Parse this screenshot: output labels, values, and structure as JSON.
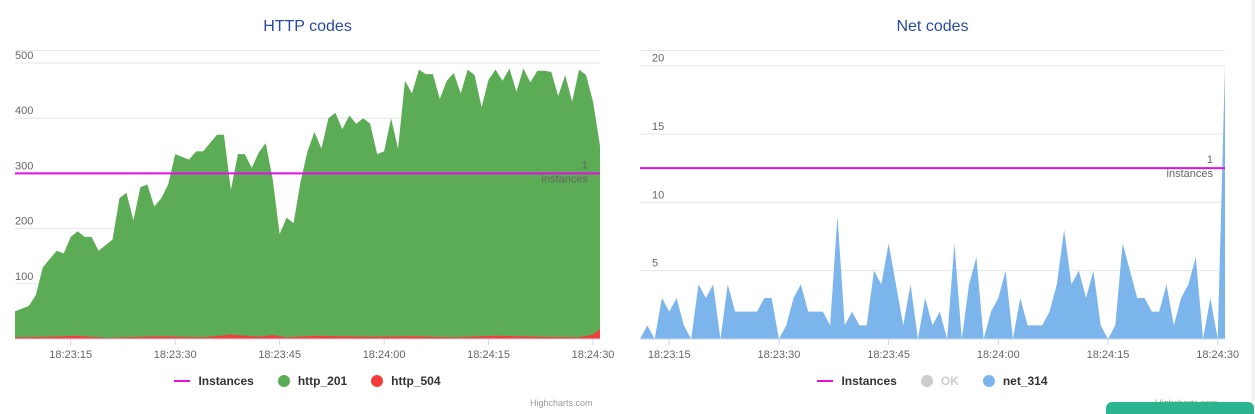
{
  "charts": [
    {
      "title": "HTTP codes",
      "credits": "Highcharts.com",
      "plot_line_label": [
        "1",
        "instances"
      ],
      "legend": [
        {
          "label": "Instances",
          "symbol": "line",
          "color": "#e60ee6",
          "disabled": false
        },
        {
          "label": "http_201",
          "symbol": "dot",
          "color": "#5bac55",
          "disabled": false
        },
        {
          "label": "http_504",
          "symbol": "dot",
          "color": "#f33e3e",
          "disabled": false
        }
      ]
    },
    {
      "title": "Net codes",
      "credits": "Highcharts.com",
      "plot_line_label": [
        "1",
        "instances"
      ],
      "legend": [
        {
          "label": "Instances",
          "symbol": "line",
          "color": "#e60ee6",
          "disabled": false
        },
        {
          "label": "OK",
          "symbol": "dot",
          "color": "#cccccc",
          "disabled": true
        },
        {
          "label": "net_314",
          "symbol": "dot",
          "color": "#7cb5ec",
          "disabled": false
        }
      ]
    }
  ],
  "chart_data": [
    {
      "type": "area",
      "title": "HTTP codes",
      "x_ticks": [
        "18:23:15",
        "18:23:30",
        "18:23:45",
        "18:24:00",
        "18:24:15",
        "18:24:30"
      ],
      "x_tick_seconds": [
        15,
        30,
        45,
        60,
        75,
        90
      ],
      "x_range_seconds": [
        7,
        91
      ],
      "y_ticks": [
        100,
        200,
        300,
        400,
        500
      ],
      "ylim": [
        0,
        520
      ],
      "grid": true,
      "plot_line": {
        "series": "Instances",
        "value": 1,
        "y_level": 300,
        "color": "#e60ee6"
      },
      "series": [
        {
          "name": "http_201",
          "color": "#5bac55",
          "x": [
            7,
            8,
            9,
            10,
            11,
            12,
            13,
            14,
            15,
            16,
            17,
            18,
            19,
            20,
            21,
            22,
            23,
            24,
            25,
            26,
            27,
            28,
            29,
            30,
            31,
            32,
            33,
            34,
            35,
            36,
            37,
            38,
            39,
            40,
            41,
            42,
            43,
            44,
            45,
            46,
            47,
            48,
            49,
            50,
            51,
            52,
            53,
            54,
            55,
            56,
            57,
            58,
            59,
            60,
            61,
            62,
            63,
            64,
            65,
            66,
            67,
            68,
            69,
            70,
            71,
            72,
            73,
            74,
            75,
            76,
            77,
            78,
            79,
            80,
            81,
            82,
            83,
            84,
            85,
            86,
            87,
            88,
            89,
            90,
            91
          ],
          "values": [
            50,
            55,
            60,
            80,
            130,
            145,
            160,
            155,
            185,
            195,
            185,
            185,
            160,
            170,
            180,
            255,
            265,
            215,
            275,
            280,
            240,
            255,
            280,
            335,
            330,
            325,
            340,
            340,
            355,
            370,
            370,
            270,
            335,
            335,
            310,
            338,
            355,
            290,
            190,
            220,
            210,
            285,
            340,
            375,
            345,
            400,
            410,
            380,
            405,
            390,
            400,
            390,
            335,
            340,
            400,
            345,
            468,
            445,
            488,
            480,
            480,
            435,
            468,
            482,
            445,
            488,
            478,
            420,
            470,
            488,
            468,
            490,
            448,
            490,
            465,
            486,
            486,
            484,
            440,
            478,
            430,
            488,
            478,
            430,
            350
          ]
        },
        {
          "name": "http_504",
          "color": "#f33e3e",
          "x": [
            7,
            12,
            16,
            20,
            28,
            34,
            38,
            42,
            44,
            46,
            50,
            58,
            64,
            70,
            76,
            82,
            88,
            90,
            91
          ],
          "values": [
            3,
            4,
            6,
            2,
            5,
            3,
            8,
            4,
            7,
            3,
            6,
            4,
            5,
            3,
            6,
            4,
            3,
            8,
            18
          ]
        }
      ]
    },
    {
      "type": "area",
      "title": "Net codes",
      "x_ticks": [
        "18:23:15",
        "18:23:30",
        "18:23:45",
        "18:24:00",
        "18:24:15",
        "18:24:30"
      ],
      "x_tick_seconds": [
        15,
        30,
        45,
        60,
        75,
        90
      ],
      "x_range_seconds": [
        11,
        91
      ],
      "y_ticks": [
        5,
        10,
        15,
        20
      ],
      "ylim": [
        0,
        21
      ],
      "grid": true,
      "plot_line": {
        "series": "Instances",
        "value": 1,
        "y_level": 12.5,
        "color": "#e60ee6"
      },
      "series": [
        {
          "name": "OK",
          "color": "#cccccc",
          "x": [],
          "values": []
        },
        {
          "name": "net_314",
          "color": "#7cb5ec",
          "x": [
            11,
            12,
            13,
            14,
            15,
            16,
            17,
            18,
            19,
            20,
            21,
            22,
            23,
            24,
            25,
            26,
            27,
            28,
            29,
            30,
            31,
            32,
            33,
            34,
            35,
            36,
            37,
            38,
            39,
            40,
            41,
            42,
            43,
            44,
            45,
            46,
            47,
            48,
            49,
            50,
            51,
            52,
            53,
            54,
            55,
            56,
            57,
            58,
            59,
            60,
            61,
            62,
            63,
            64,
            65,
            66,
            67,
            68,
            69,
            70,
            71,
            72,
            73,
            74,
            75,
            76,
            77,
            78,
            79,
            80,
            81,
            82,
            83,
            84,
            85,
            86,
            87,
            88,
            89,
            90,
            91
          ],
          "values": [
            0,
            1,
            0,
            3,
            2,
            3,
            1,
            0,
            4,
            3,
            4,
            0,
            4,
            2,
            2,
            2,
            2,
            3,
            3,
            0,
            1,
            3,
            4,
            2,
            2,
            2,
            1,
            9,
            1,
            2,
            1,
            1,
            5,
            4,
            7,
            4,
            1,
            4,
            0,
            3,
            1,
            2,
            0,
            7,
            0,
            4,
            6,
            0,
            2,
            3,
            5,
            0,
            3,
            1,
            1,
            1,
            2,
            4,
            8,
            4,
            5,
            3,
            5,
            1,
            0,
            1,
            7,
            5,
            3,
            3,
            2,
            2,
            4,
            1,
            3,
            4,
            6,
            0,
            3,
            0,
            20
          ]
        }
      ]
    }
  ]
}
